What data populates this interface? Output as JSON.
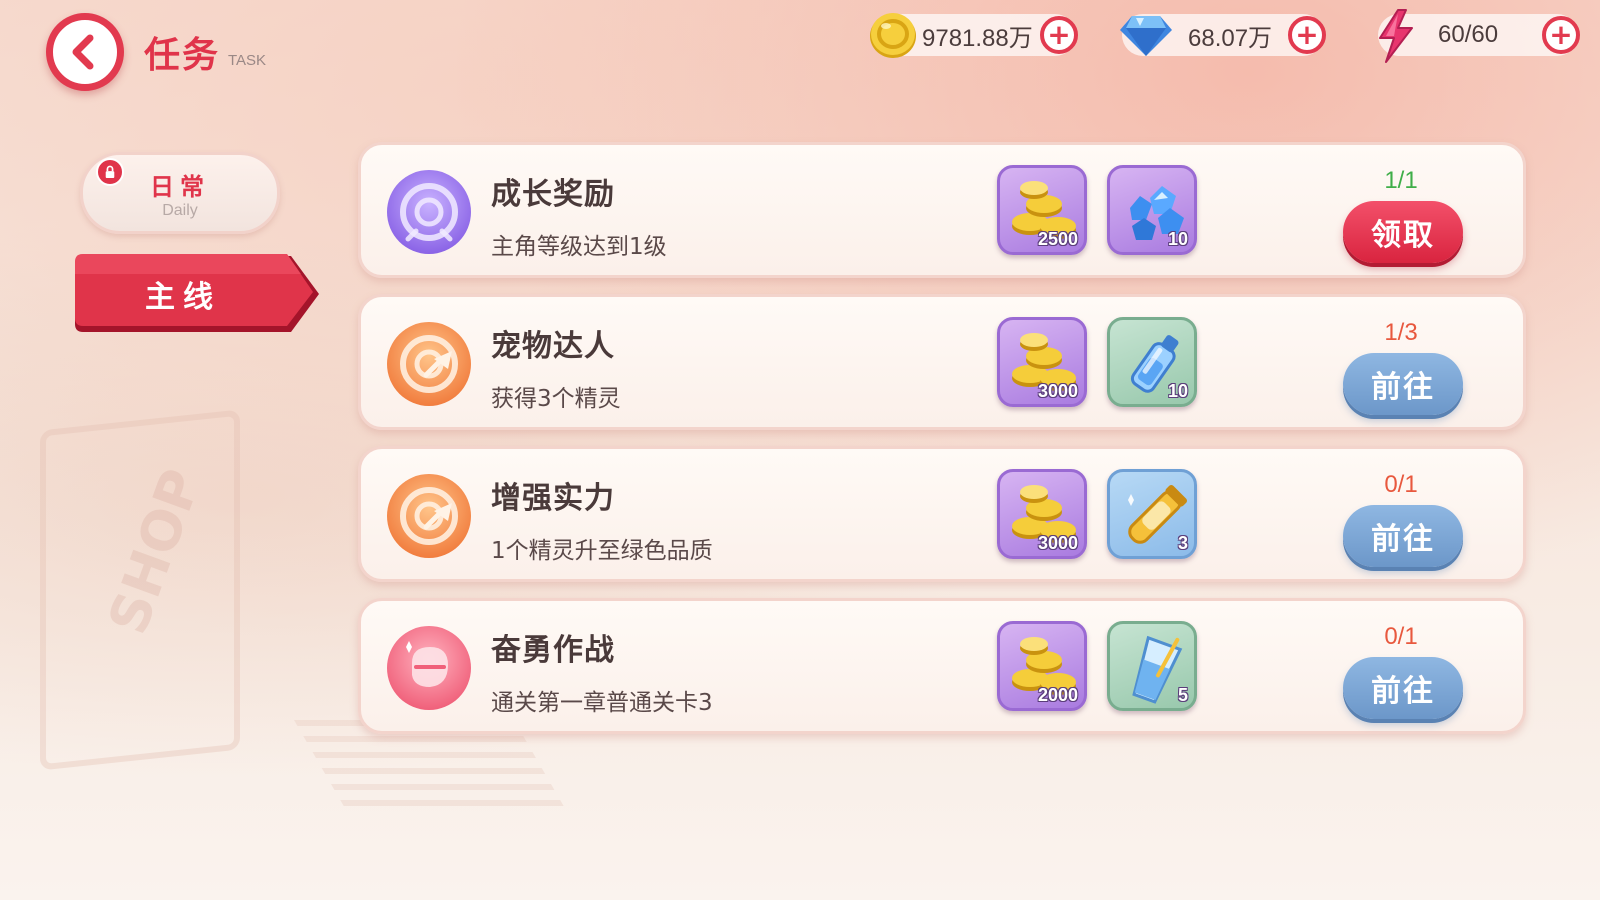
{
  "header": {
    "title": "任务",
    "subtitle": "TASK",
    "back_icon": "back-arrow-icon"
  },
  "resources": [
    {
      "name": "gold",
      "value": "9781.88万",
      "icon": "gold-coin-icon"
    },
    {
      "name": "diamond",
      "value": "68.07万",
      "icon": "diamond-icon"
    },
    {
      "name": "energy",
      "value": "60/60",
      "icon": "lightning-icon"
    }
  ],
  "tabs": {
    "daily": {
      "label": "日常",
      "sublabel": "Daily",
      "locked": true
    },
    "main": {
      "label": "主线",
      "selected": true
    }
  },
  "colors": {
    "accent": "#e0344a",
    "progress_complete": "#3fae49",
    "progress_incomplete": "#e8583e",
    "go_button": "#7aa3d3"
  },
  "tasks": [
    {
      "title": "成长奖励",
      "desc": "主角等级达到1级",
      "icon": "target-purple-icon",
      "rewards": [
        {
          "item": "gold-coins",
          "qty": "2500"
        },
        {
          "item": "blue-crystals",
          "qty": "10"
        }
      ],
      "progress": "1/1",
      "progress_state": "complete",
      "action": "领取",
      "action_type": "claim"
    },
    {
      "title": "宠物达人",
      "desc": "获得3个精灵",
      "icon": "target-orange-icon",
      "rewards": [
        {
          "item": "gold-coins",
          "qty": "3000"
        },
        {
          "item": "potion-bottle",
          "qty": "10"
        }
      ],
      "progress": "1/3",
      "progress_state": "incomplete",
      "action": "前往",
      "action_type": "go"
    },
    {
      "title": "增强实力",
      "desc": "1个精灵升至绿色品质",
      "icon": "target-orange-icon",
      "rewards": [
        {
          "item": "gold-coins",
          "qty": "3000"
        },
        {
          "item": "golden-tube",
          "qty": "3"
        }
      ],
      "progress": "0/1",
      "progress_state": "incomplete",
      "action": "前往",
      "action_type": "go"
    },
    {
      "title": "奋勇作战",
      "desc": "通关第一章普通关卡3",
      "icon": "battle-glove-icon",
      "rewards": [
        {
          "item": "gold-coins",
          "qty": "2000"
        },
        {
          "item": "water-glass",
          "qty": "5"
        }
      ],
      "progress": "0/1",
      "progress_state": "incomplete",
      "action": "前往",
      "action_type": "go"
    }
  ]
}
